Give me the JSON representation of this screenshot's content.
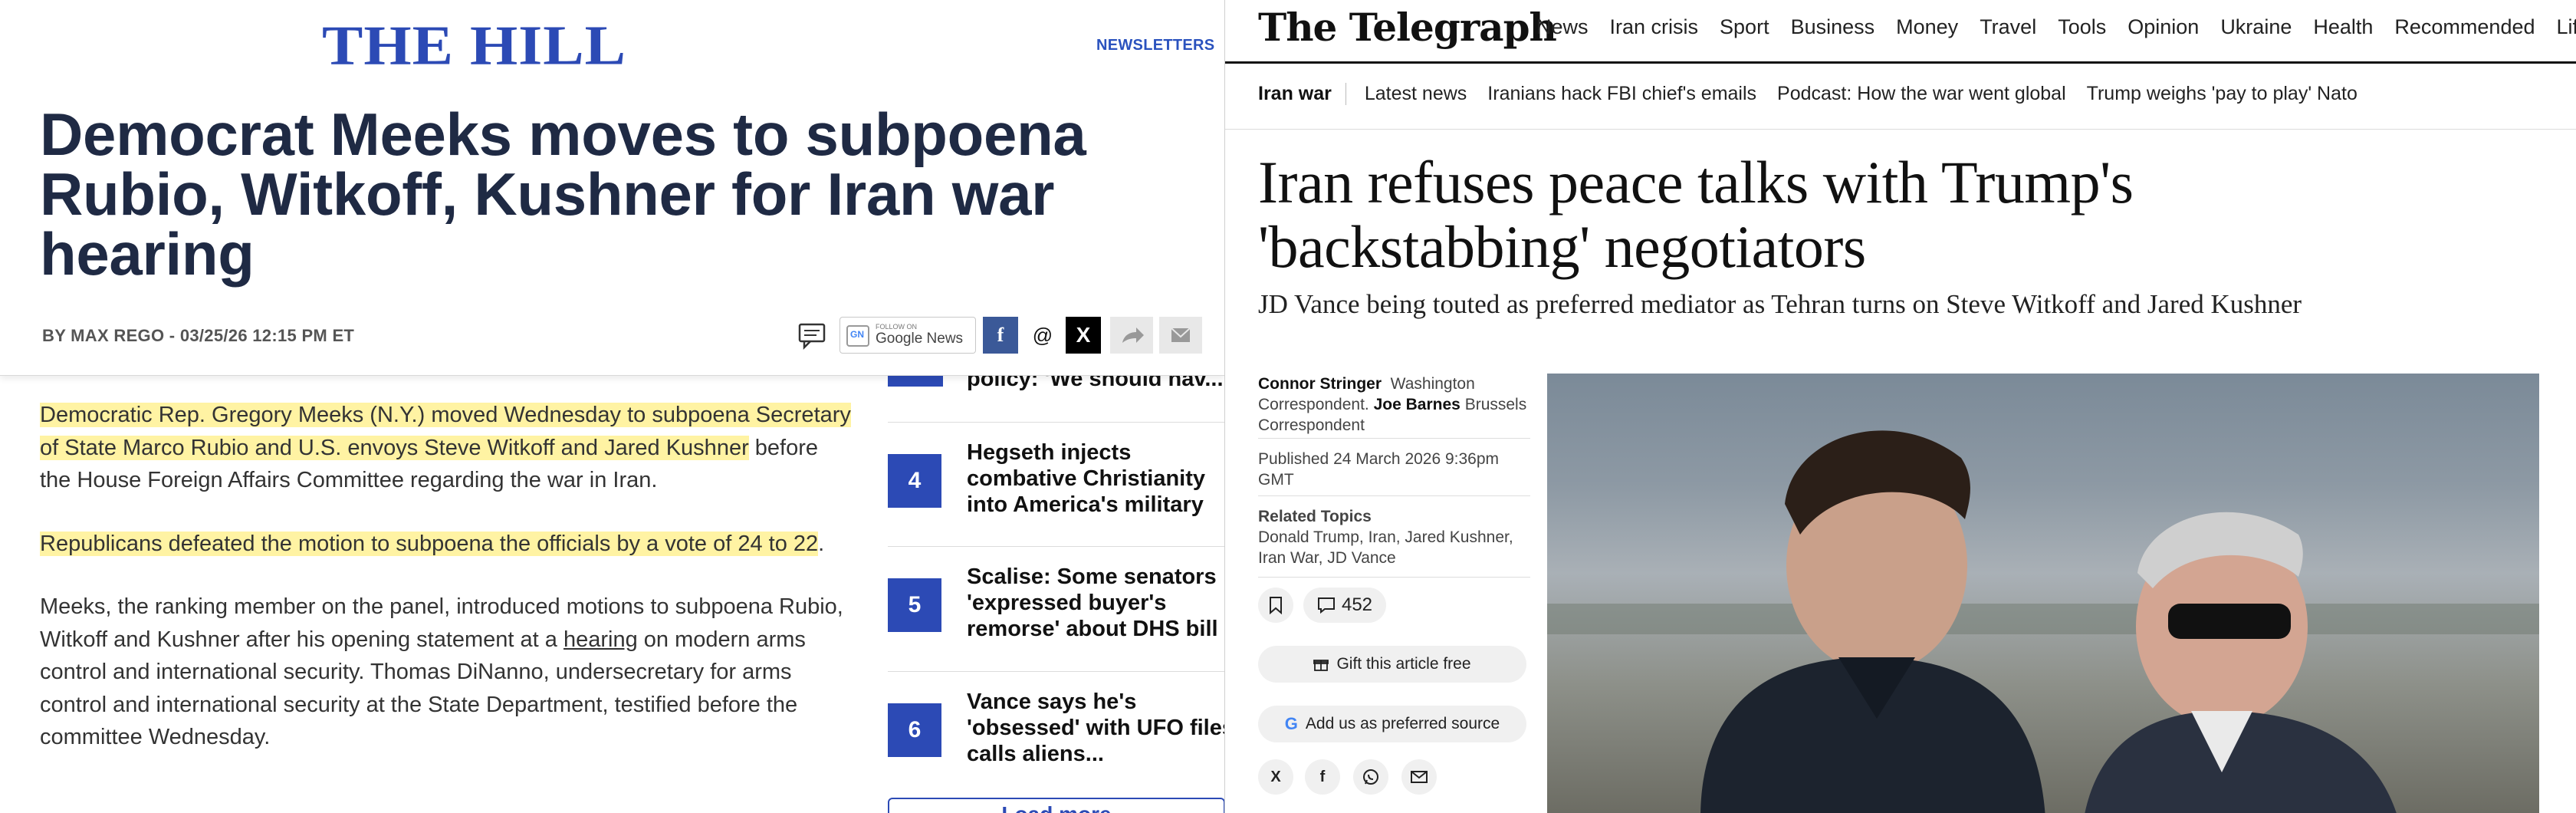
{
  "hill": {
    "logo": "THE HILL",
    "newsletters": "NEWSLETTERS",
    "headline": "Democrat Meeks moves to subpoena Rubio, Witkoff, Kushner for Iran war hearing",
    "byline": "BY MAX REGO - 03/25/26 12:15 PM ET",
    "google_follow": "FOLLOW ON",
    "google_news": "Google News",
    "article": {
      "p1_hl": "Democratic Rep. Gregory Meeks (N.Y.) moved Wednesday to subpoena Secretary of State Marco Rubio and U.S. envoys Steve Witkoff and Jared Kushner",
      "p1_rest": " before the House Foreign Affairs Committee regarding the war in Iran.",
      "p2_hl": "Republicans defeated the motion to subpoena the officials by a vote of 24 to 22",
      "p2_rest": ".",
      "p3_a": "Meeks, the ranking member on the panel, introduced motions to subpoena Rubio, Witkoff and Kushner after his opening statement at a ",
      "p3_link": "hearing",
      "p3_b": " on modern arms control and international security. Thomas DiNanno, undersecretary for arms control and international security at the State Department, testified before the committee Wednesday."
    },
    "trending": {
      "top_partial": "policy: 'We should hav...",
      "items": [
        {
          "num": "4",
          "title": "Hegseth injects combative Christianity into America's military"
        },
        {
          "num": "5",
          "title": "Scalise: Some senators 'expressed buyer's remorse' about DHS bill"
        },
        {
          "num": "6",
          "title": "Vance says he's 'obsessed' with UFO files, calls aliens..."
        }
      ],
      "load_more": "Load more"
    }
  },
  "telegraph": {
    "logo": "The Telegraph",
    "nav": [
      "News",
      "Iran crisis",
      "Sport",
      "Business",
      "Money",
      "Travel",
      "Tools",
      "Opinion",
      "Ukraine",
      "Health",
      "Recommended",
      "Lifest"
    ],
    "subnav_first": "Iran war",
    "subnav": [
      "Latest news",
      "Iranians hack FBI chief's emails",
      "Podcast: How the war went global",
      "Trump weighs 'pay to play' Nato"
    ],
    "headline": "Iran refuses peace talks with Trump's 'backstabbing' negotiators",
    "standfirst": "JD Vance being touted as preferred mediator as Tehran turns on Steve Witkoff and Jared Kushner",
    "author1": "Connor Stringer",
    "author1_role": "Washington Correspondent.",
    "author2": "Joe Barnes",
    "author2_role": "Brussels Correspondent",
    "published": "Published 24 March 2026 9:36pm GMT",
    "related_head": "Related Topics",
    "related": "Donald Trump, Iran, Jared Kushner, Iran War, JD Vance",
    "comment_count": "452",
    "gift": "Gift this article free",
    "preferred": "Add us as preferred source",
    "icons": [
      "bookmark-icon",
      "comment-icon",
      "gift-icon",
      "google-icon",
      "x-icon",
      "facebook-icon",
      "whatsapp-icon",
      "email-icon"
    ]
  }
}
